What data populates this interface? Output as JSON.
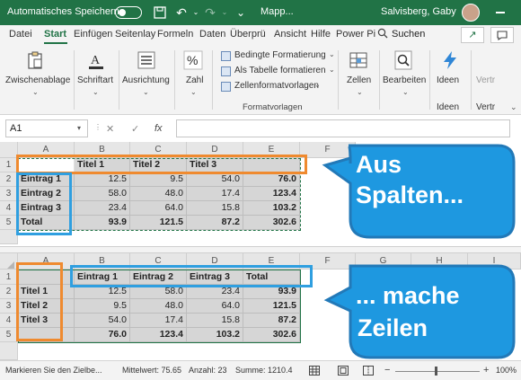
{
  "titlebar": {
    "autosave_label": "Automatisches Speichern",
    "document_name": "Mapp...",
    "user_name": "Salvisberg, Gaby"
  },
  "ribbon_tabs": [
    "Datei",
    "Start",
    "Einfügen",
    "Seitenlay",
    "Formeln",
    "Daten",
    "Überprü",
    "Ansicht",
    "Hilfe",
    "Power Pi"
  ],
  "active_tab": "Start",
  "search_label": "Suchen",
  "ribbon": {
    "clipboard": "Zwischenablage",
    "font": "Schriftart",
    "alignment": "Ausrichtung",
    "number": "Zahl",
    "conditional_formatting": "Bedingte Formatierung",
    "format_as_table": "Als Tabelle formatieren",
    "cell_styles": "Zellenformatvorlagen",
    "styles_group": "Formatvorlagen",
    "cells": "Zellen",
    "editing": "Bearbeiten",
    "ideas_button": "Ideen",
    "ideas_group": "Ideen",
    "vert_partial": "Vertr",
    "vert_partial2": "Vertr"
  },
  "formula_bar": {
    "name_box": "A1",
    "cancel": "✕",
    "enter": "✓",
    "fx": "fx"
  },
  "columns": [
    "A",
    "B",
    "C",
    "D",
    "E",
    "F",
    "G",
    "H",
    "I"
  ],
  "top_table": {
    "rows": [
      "1",
      "2",
      "3",
      "4",
      "5"
    ],
    "cells": [
      [
        "",
        "Titel 1",
        "Titel 2",
        "Titel 3",
        ""
      ],
      [
        "Eintrag 1",
        "12.5",
        "9.5",
        "54.0",
        "76.0"
      ],
      [
        "Eintrag 2",
        "58.0",
        "48.0",
        "17.4",
        "123.4"
      ],
      [
        "Eintrag 3",
        "23.4",
        "64.0",
        "15.8",
        "103.2"
      ],
      [
        "Total",
        "93.9",
        "121.5",
        "87.2",
        "302.6"
      ]
    ]
  },
  "bottom_table": {
    "rows": [
      "1",
      "2",
      "3",
      "4",
      "5"
    ],
    "cells": [
      [
        "",
        "Eintrag 1",
        "Eintrag 2",
        "Eintrag 3",
        "Total"
      ],
      [
        "Titel 1",
        "12.5",
        "58.0",
        "23.4",
        "93.9"
      ],
      [
        "Titel 2",
        "9.5",
        "48.0",
        "64.0",
        "121.5"
      ],
      [
        "Titel 3",
        "54.0",
        "17.4",
        "15.8",
        "87.2"
      ],
      [
        "",
        "76.0",
        "123.4",
        "103.2",
        "302.6"
      ]
    ]
  },
  "callouts": {
    "top_line1": "Aus",
    "top_line2": "Spalten...",
    "bottom_line1": "... mache",
    "bottom_line2": "Zeilen"
  },
  "status_bar": {
    "mode": "Markieren Sie den Zielbe...",
    "average": "Mittelwert: 75.65",
    "count": "Anzahl: 23",
    "sum": "Summe: 1210.4",
    "zoom": "100%"
  },
  "colors": {
    "excel_green": "#217346",
    "highlight_orange": "#ef8a2f",
    "highlight_blue": "#2f9fe0"
  }
}
